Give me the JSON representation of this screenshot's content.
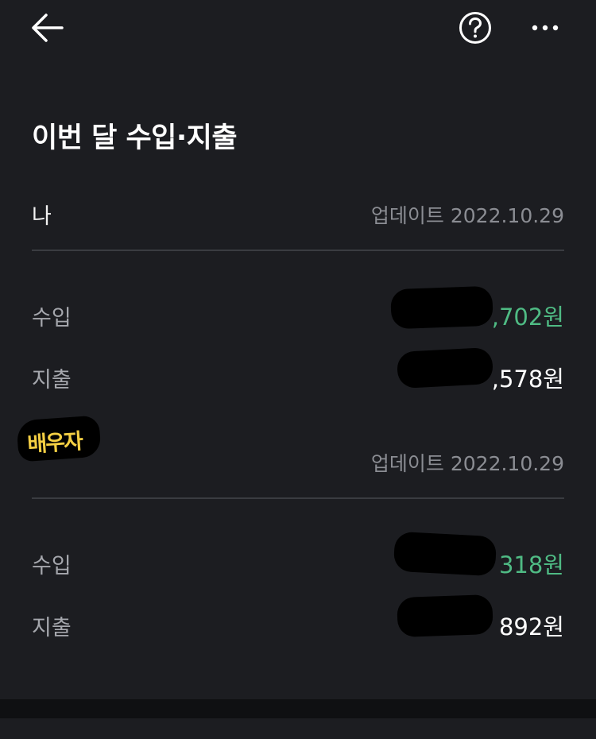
{
  "header": {
    "back_icon": "arrow-left-icon",
    "help_icon": "question-circle-icon",
    "more_icon": "more-horizontal-icon"
  },
  "title": "이번 달 수입·지출",
  "sections": [
    {
      "owner": "나",
      "updated": "업데이트 2022.10.29",
      "income_label": "수입",
      "income_value": ",702원",
      "expense_label": "지출",
      "expense_value": ",578원"
    },
    {
      "owner": "배우자",
      "updated": "업데이트 2022.10.29",
      "income_label": "수입",
      "income_value": "318원",
      "expense_label": "지출",
      "expense_value": "892원"
    }
  ],
  "colors": {
    "background": "#1c1d21",
    "income": "#4fbb84",
    "muted": "#8b8d93",
    "sticker_text": "#f4cf43"
  }
}
